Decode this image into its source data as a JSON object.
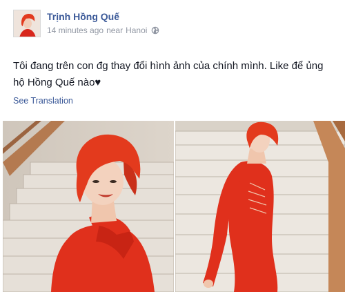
{
  "post": {
    "author": "Trịnh Hồng Quế",
    "time": "14 minutes ago",
    "location_prefix": "near",
    "location": "Hanoi",
    "text": "Tôi đang trên con đg thay đổi hình ảnh của chính mình. Like để ủng hộ Hồng Quế nào♥",
    "translate_label": "See Translation",
    "privacy_icon": "globe-icon"
  },
  "colors": {
    "link": "#3b5998",
    "meta": "#9197a3",
    "text": "#141823"
  }
}
